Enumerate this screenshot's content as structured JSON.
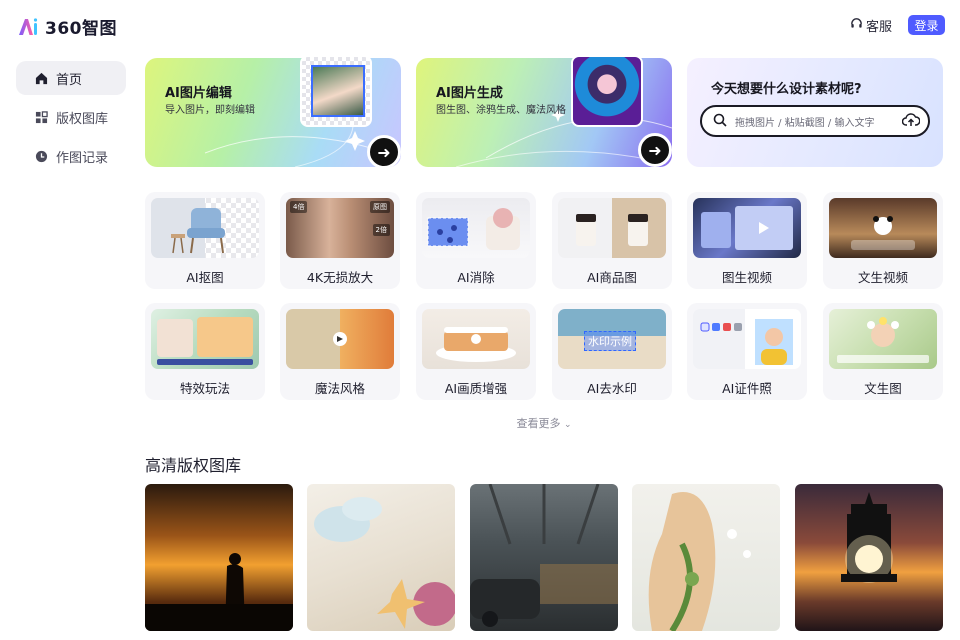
{
  "app": {
    "logo_text": "360智图"
  },
  "header": {
    "support_label": "客服",
    "login_label": "登录"
  },
  "sidebar": {
    "items": [
      {
        "label": "首页",
        "icon": "home-icon",
        "active": true
      },
      {
        "label": "版权图库",
        "icon": "grid-icon",
        "active": false
      },
      {
        "label": "作图记录",
        "icon": "clock-icon",
        "active": false
      }
    ]
  },
  "hero": {
    "edit": {
      "title": "AI图片编辑",
      "subtitle": "导入图片，即刻编辑"
    },
    "generate": {
      "title": "AI图片生成",
      "subtitle": "图生图、涂鸦生成、魔法风格"
    },
    "search": {
      "title": "今天想要什么设计素材呢?",
      "placeholder": "拖拽图片 / 粘贴截图 / 输入文字"
    }
  },
  "features": [
    {
      "label": "AI抠图"
    },
    {
      "label": "4K无损放大"
    },
    {
      "label": "AI消除"
    },
    {
      "label": "AI商品图"
    },
    {
      "label": "图生视频"
    },
    {
      "label": "文生视频"
    },
    {
      "label": "特效玩法"
    },
    {
      "label": "魔法风格"
    },
    {
      "label": "AI画质增强"
    },
    {
      "label": "AI去水印"
    },
    {
      "label": "AI证件照"
    },
    {
      "label": "文生图"
    }
  ],
  "tile_captions": {
    "scale_4x": "4倍",
    "original": "原图",
    "scale_2x": "2倍",
    "watermark_text": "水印示例"
  },
  "more_label": "查看更多",
  "gallery": {
    "title": "高清版权图库",
    "photos": [
      "sunset-silhouette",
      "beach-shells",
      "steampunk-train",
      "floral-woman",
      "lighthouse-sunset"
    ]
  },
  "colors": {
    "accent": "#4f5bff",
    "tile_bg": "#f6f6f9",
    "sidebar_active": "#f0f0f4"
  }
}
